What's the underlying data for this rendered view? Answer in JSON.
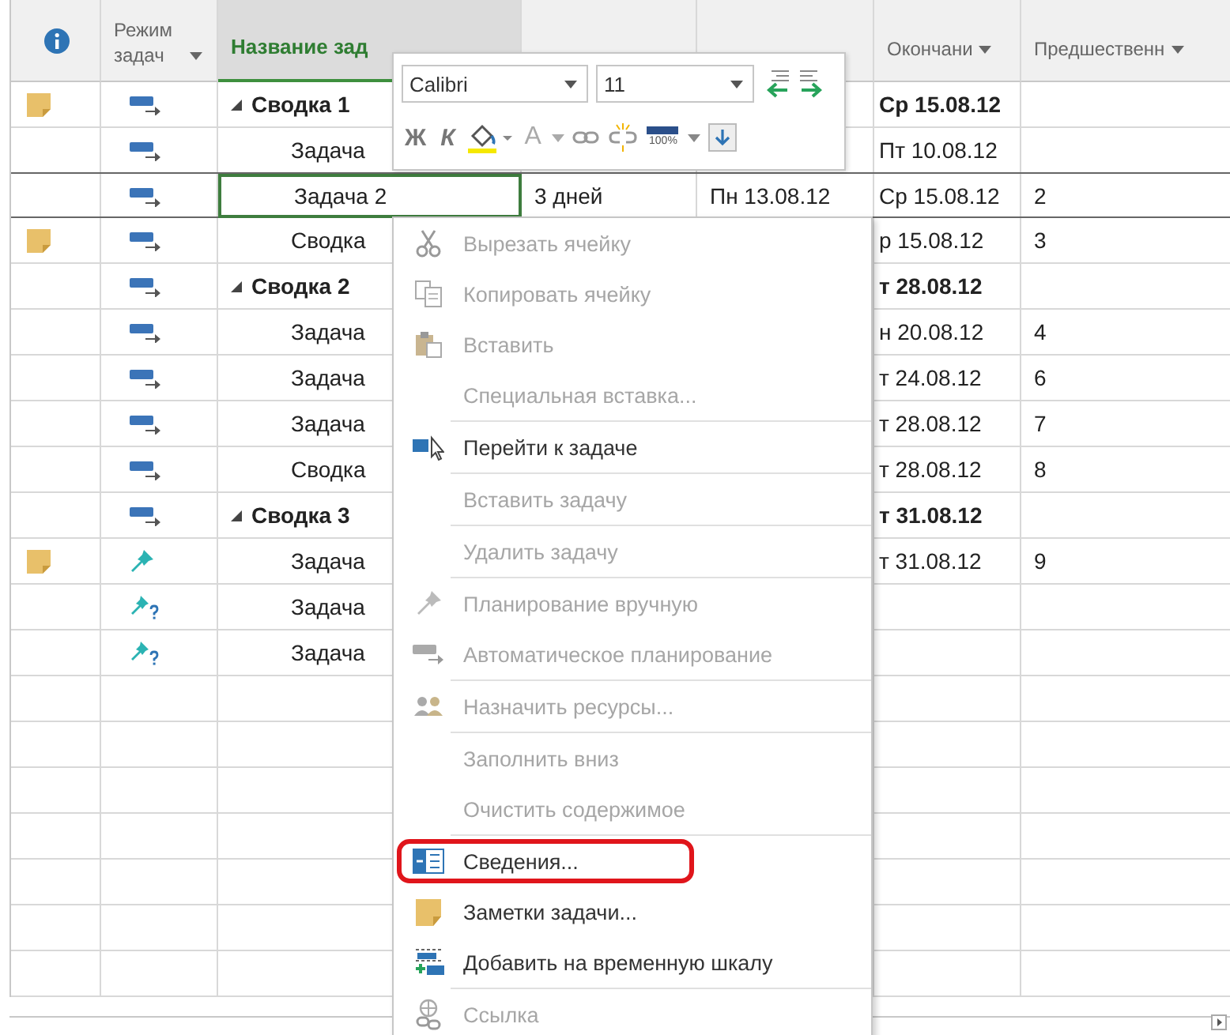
{
  "table": {
    "columns": [
      {
        "kind": "info",
        "has_menu": false,
        "active": false
      },
      {
        "kind": "mode",
        "label": "Режим задач",
        "has_menu": true,
        "active": false
      },
      {
        "kind": "name",
        "label": "Название зад",
        "has_menu": false,
        "active": true
      },
      {
        "kind": "duration",
        "has_menu": false,
        "active": false
      },
      {
        "kind": "start",
        "has_menu": false,
        "active": false
      },
      {
        "kind": "finish",
        "label": "Окончани",
        "has_menu": true,
        "active": false
      },
      {
        "kind": "predecessors",
        "label": "Предшественн",
        "has_menu": true,
        "active": false
      }
    ],
    "rows": [
      {
        "kind": "summary",
        "name": "Сводка 1",
        "expanded": true,
        "note": true,
        "mode": {
          "kind": "auto"
        },
        "selected": false,
        "finish": "Ср 15.08.12",
        "children": [
          {
            "kind": "task",
            "name": "Задача",
            "note": false,
            "mode": {
              "kind": "auto"
            },
            "selected": false,
            "finish": "Пт 10.08.12"
          },
          {
            "kind": "task",
            "name": "Задача 2",
            "note": false,
            "mode": {
              "kind": "auto"
            },
            "selected": true,
            "duration": "3 дней",
            "start": "Пн 13.08.12",
            "finish": "Ср 15.08.12",
            "predecessors": "2"
          },
          {
            "kind": "task",
            "name": "Сводка",
            "note": true,
            "mode": {
              "kind": "auto"
            },
            "selected": false,
            "finish": "р 15.08.12",
            "predecessors": "3"
          }
        ]
      },
      {
        "kind": "summary",
        "name": "Сводка 2",
        "expanded": true,
        "note": false,
        "mode": {
          "kind": "auto"
        },
        "selected": false,
        "finish": "т 28.08.12",
        "children": [
          {
            "kind": "task",
            "name": "Задача",
            "note": false,
            "mode": {
              "kind": "auto"
            },
            "selected": false,
            "finish": "н 20.08.12",
            "predecessors": "4"
          },
          {
            "kind": "task",
            "name": "Задача",
            "note": false,
            "mode": {
              "kind": "auto"
            },
            "selected": false,
            "finish": "т 24.08.12",
            "predecessors": "6"
          },
          {
            "kind": "task",
            "name": "Задача",
            "note": false,
            "mode": {
              "kind": "auto"
            },
            "selected": false,
            "finish": "т 28.08.12",
            "predecessors": "7"
          },
          {
            "kind": "task",
            "name": "Сводка",
            "note": false,
            "mode": {
              "kind": "auto"
            },
            "selected": false,
            "finish": "т 28.08.12",
            "predecessors": "8"
          }
        ]
      },
      {
        "kind": "summary",
        "name": "Сводка 3",
        "expanded": true,
        "note": false,
        "mode": {
          "kind": "auto"
        },
        "selected": false,
        "finish": "т 31.08.12",
        "children": [
          {
            "kind": "task",
            "name": "Задача",
            "note": true,
            "mode": {
              "kind": "manual"
            },
            "selected": false,
            "finish": "т 31.08.12",
            "predecessors": "9"
          },
          {
            "kind": "task",
            "name": "Задача",
            "note": false,
            "mode": {
              "kind": "unscheduled"
            },
            "selected": false
          },
          {
            "kind": "task",
            "name": "Задача",
            "note": false,
            "mode": {
              "kind": "unscheduled"
            },
            "selected": false
          }
        ]
      }
    ]
  },
  "mini_toolbar": {
    "font": "Calibri",
    "size": "11",
    "bold": "Ж",
    "italic": "К",
    "font_color": "A",
    "progress": "100%"
  },
  "context_menu": {
    "groups": [
      [
        {
          "label": "Вырезать ячейку",
          "disabled": true,
          "highlighted": false
        },
        {
          "label": "Копировать ячейку",
          "disabled": true,
          "highlighted": false
        },
        {
          "label": "Вставить",
          "disabled": true,
          "highlighted": false
        },
        {
          "label": "Специальная вставка...",
          "disabled": true,
          "highlighted": false
        }
      ],
      [
        {
          "label": "Перейти к задаче",
          "disabled": false,
          "highlighted": false
        }
      ],
      [
        {
          "label": "Вставить задачу",
          "disabled": true,
          "highlighted": false
        }
      ],
      [
        {
          "label": "Удалить задачу",
          "disabled": true,
          "highlighted": false
        }
      ],
      [
        {
          "label": "Планирование вручную",
          "disabled": true,
          "highlighted": false
        },
        {
          "label": "Автоматическое планирование",
          "disabled": true,
          "highlighted": false
        }
      ],
      [
        {
          "label": "Назначить ресурсы...",
          "disabled": true,
          "highlighted": false
        }
      ],
      [
        {
          "label": "Заполнить вниз",
          "disabled": true,
          "highlighted": false
        },
        {
          "label": "Очистить содержимое",
          "disabled": true,
          "highlighted": false
        }
      ],
      [
        {
          "label": "Сведения...",
          "disabled": false,
          "highlighted": true
        },
        {
          "label": "Заметки задачи...",
          "disabled": false,
          "highlighted": false
        },
        {
          "label": "Добавить на временную шкалу",
          "disabled": false,
          "highlighted": false
        }
      ],
      [
        {
          "label": "Ссылка",
          "disabled": true,
          "highlighted": false
        }
      ]
    ]
  }
}
